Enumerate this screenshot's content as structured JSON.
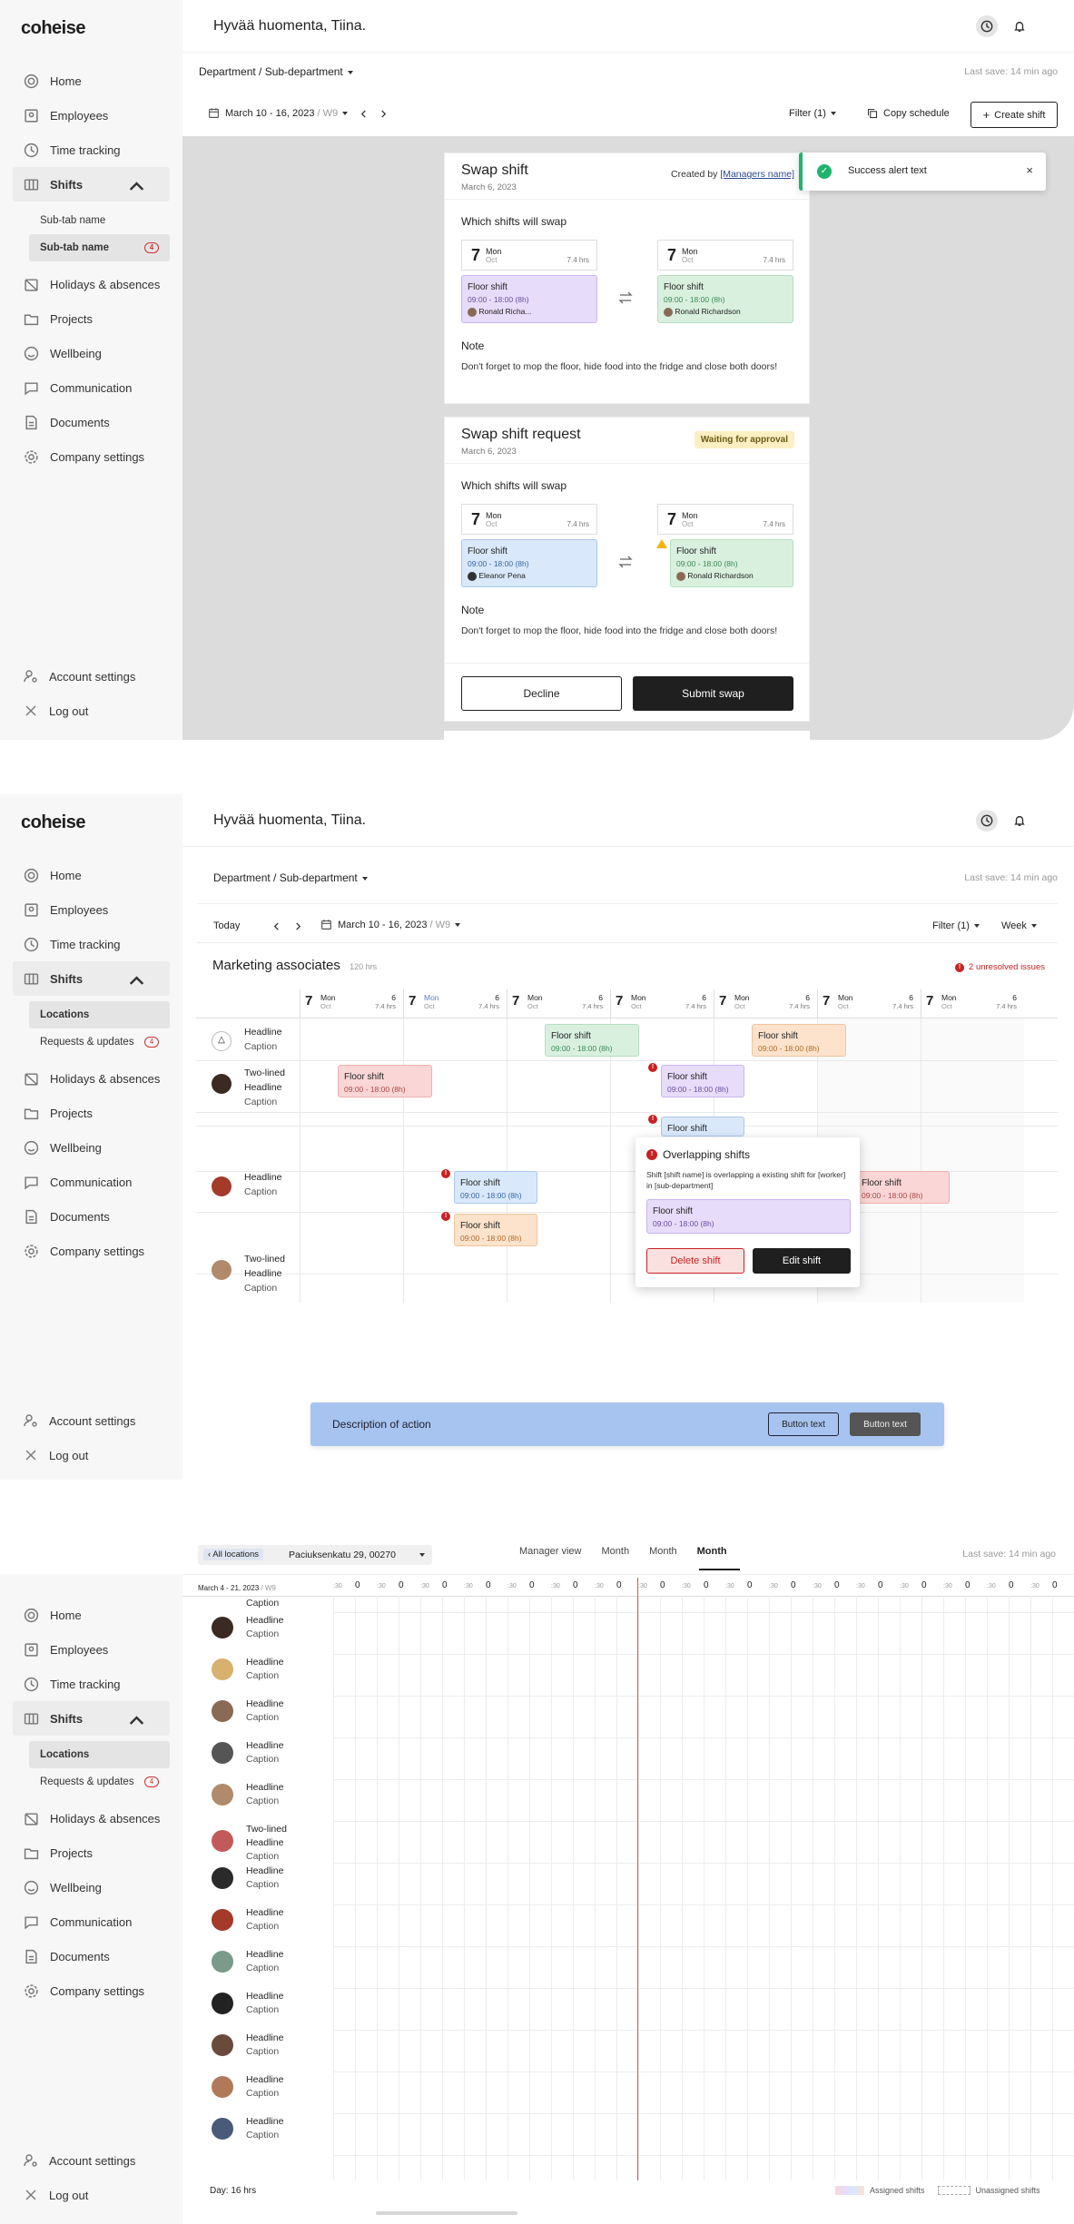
{
  "app": {
    "logo": "coheise",
    "greeting": "Hyvää huomenta, Tiina."
  },
  "nav": {
    "home": "Home",
    "employees": "Employees",
    "time_tracking": "Time tracking",
    "shifts": "Shifts",
    "holidays": "Holidays & absences",
    "projects": "Projects",
    "wellbeing": "Wellbeing",
    "communication": "Communication",
    "documents": "Documents",
    "company_settings": "Company settings",
    "account_settings": "Account settings",
    "log_out": "Log out"
  },
  "frame1": {
    "sub_tab_1": "Sub-tab name",
    "sub_tab_2": "Sub-tab name",
    "sub_badge": "4",
    "dept": "Department / Sub-department",
    "last_save": "Last save: 14 min ago",
    "date_range": "March 10 - 16, 2023",
    "week": "/ W9",
    "filter": "Filter (1)",
    "copy": "Copy schedule",
    "create": "Create shift",
    "toast": "Success alert text",
    "swap": {
      "title": "Swap shift",
      "date": "March 6, 2023",
      "created_by": "Created by",
      "manager": "[Managers name]",
      "which": "Which shifts will swap",
      "day_num": "7",
      "day_name": "Mon",
      "day_month": "Oct",
      "hrs": "7.4 hrs",
      "left_title": "Floor shift",
      "left_time": "09:00 - 18:00 (8h)",
      "left_person": "Ronald Richa...",
      "right_title": "Floor shift",
      "right_time": "09:00 - 18:00 (8h)",
      "right_person": "Ronald Richardson",
      "note_label": "Note",
      "note_text": "Don't forget to mop the floor, hide food into the fridge and close both doors!"
    },
    "request": {
      "title": "Swap shift request",
      "date": "March 6, 2023",
      "status": "Waiting for approval",
      "which": "Which shifts will swap",
      "left_title": "Floor shift",
      "left_time": "09:00 - 18:00 (8h)",
      "left_person": "Eleanor Pena",
      "right_title": "Floor shift",
      "right_time": "09:00 - 18:00 (8h)",
      "right_person": "Ronald Richardson",
      "note_label": "Note",
      "note_text": "Don't forget to mop the floor, hide food into the fridge and close both doors!",
      "decline": "Decline",
      "submit": "Submit swap"
    }
  },
  "frame2": {
    "locations": "Locations",
    "requests": "Requests & updates",
    "req_badge": "4",
    "dept": "Department / Sub-department",
    "last_save": "Last save: 14 min ago",
    "today": "Today",
    "date_range": "March 10 - 16, 2023",
    "week": "/ W9",
    "filter": "Filter (1)",
    "view": "Week",
    "group": "Marketing associates",
    "group_hrs": "120 hrs",
    "issues": "2 unresolved issues",
    "day_num": "7",
    "day_name": "Mon",
    "day_month": "Oct",
    "day_count": "6",
    "hrs": "7.4 hrs",
    "rows": [
      {
        "l1": "Headline",
        "l2": "",
        "cap": "Caption"
      },
      {
        "l1": "Two-lined",
        "l2": "Headline",
        "cap": "Caption"
      },
      {
        "l1": "Headline",
        "l2": "",
        "cap": "Caption"
      },
      {
        "l1": "Two-lined",
        "l2": "Headline",
        "cap": "Caption"
      }
    ],
    "shift_title": "Floor shift",
    "shift_time": "09:00 - 18:00 (8h)",
    "popup": {
      "title": "Overlapping shifts",
      "text": "Shift [shift name] is overlapping a existing shift for [worker] in [sub-department]",
      "shift_title": "Floor shift",
      "shift_time": "09:00 - 18:00 (8h)",
      "delete": "Delete shift",
      "edit": "Edit shift"
    },
    "action_bar": {
      "text": "Description of action",
      "btn1": "Button text",
      "btn2": "Button text"
    }
  },
  "frame3": {
    "locations": "Locations",
    "requests": "Requests & updates",
    "req_badge": "4",
    "all_locations": "All locations",
    "address": "Paciuksenkatu 29, 00270",
    "tabs": [
      "Manager view",
      "Month",
      "Month",
      "Month"
    ],
    "last_save": "Last save: 14 min ago",
    "date_range": "March 4 - 21, 2023",
    "week": "/ W9",
    "timeline": [
      ":30",
      "0",
      ":30",
      "0",
      ":30",
      "0",
      ":30",
      "0",
      ":30",
      "0",
      ":30",
      "0",
      ":30",
      "0",
      ":30",
      "0",
      ":30",
      "0",
      ":30",
      "0",
      ":30",
      "0",
      ":30",
      "0",
      ":30",
      "0",
      ":30",
      "0",
      ":30",
      "0",
      ":30",
      "0",
      ":30",
      "0"
    ],
    "top_caption": "Caption",
    "rows": [
      {
        "l1": "Headline",
        "l2": "",
        "cap": "Caption"
      },
      {
        "l1": "Headline",
        "l2": "",
        "cap": "Caption"
      },
      {
        "l1": "Headline",
        "l2": "",
        "cap": "Caption"
      },
      {
        "l1": "Headline",
        "l2": "",
        "cap": "Caption"
      },
      {
        "l1": "Headline",
        "l2": "",
        "cap": "Caption"
      },
      {
        "l1": "Two-lined",
        "l2": "Headline",
        "cap": "Caption"
      },
      {
        "l1": "Headline",
        "l2": "",
        "cap": "Caption"
      },
      {
        "l1": "Headline",
        "l2": "",
        "cap": "Caption"
      },
      {
        "l1": "Headline",
        "l2": "",
        "cap": "Caption"
      },
      {
        "l1": "Headline",
        "l2": "",
        "cap": "Caption"
      },
      {
        "l1": "Headline",
        "l2": "",
        "cap": "Caption"
      },
      {
        "l1": "Headline",
        "l2": "",
        "cap": "Caption"
      },
      {
        "l1": "Headline",
        "l2": "",
        "cap": "Caption"
      }
    ],
    "day_total": "Day: 16 hrs",
    "legend_assigned": "Assigned shifts",
    "legend_unassigned": "Unassigned shifts"
  },
  "colors": {
    "success": "#20b36b",
    "error": "#c72222",
    "dark": "#1f1f1f",
    "action_bar": "#a7c3ef"
  }
}
